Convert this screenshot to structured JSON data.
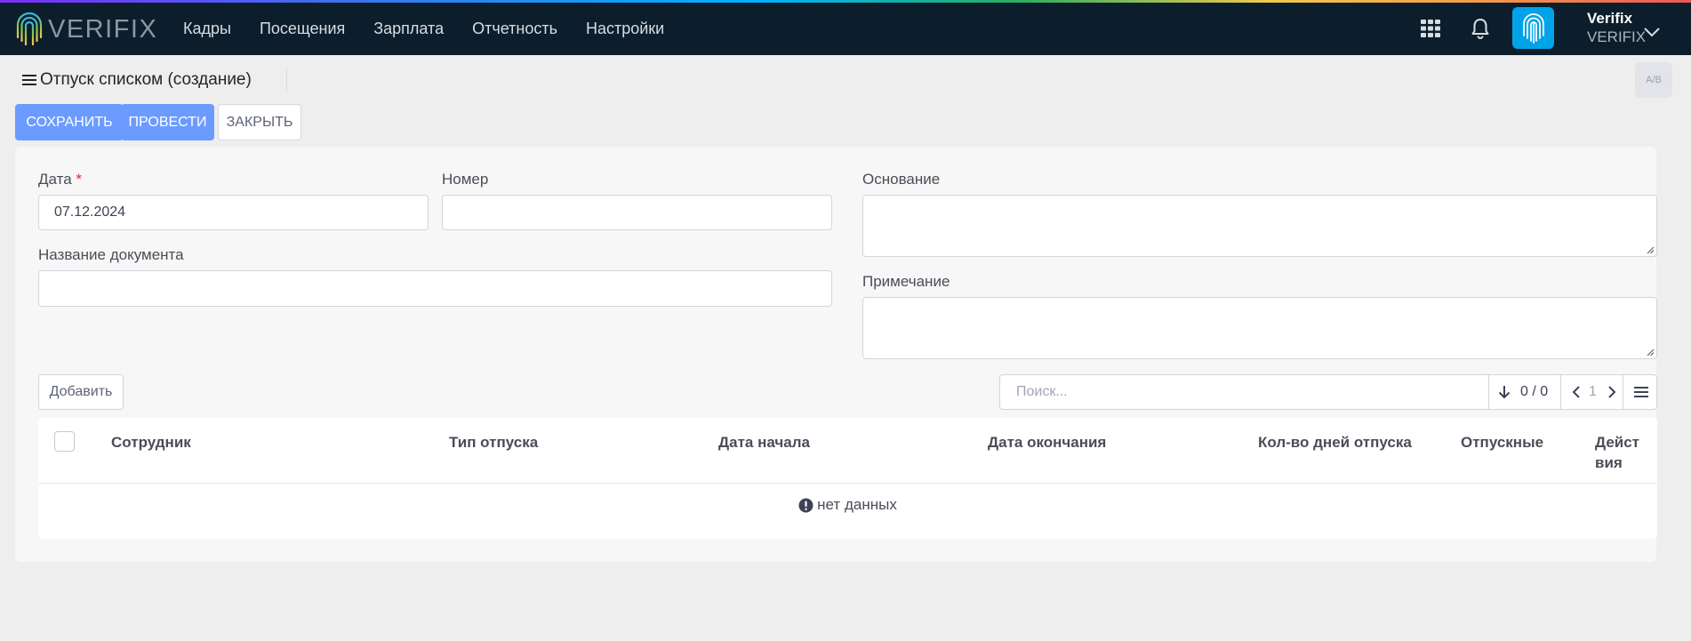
{
  "app": {
    "brand": "VERIFIX",
    "nav": [
      "Кадры",
      "Посещения",
      "Зарплата",
      "Отчетность",
      "Настройки"
    ],
    "user": {
      "name": "Verifix",
      "org": "VERIFIX"
    },
    "icons": {
      "apps": "grid-icon",
      "bell": "bell-icon",
      "avatar": "fingerprint-icon",
      "chevron": "chevron-down-icon"
    }
  },
  "page": {
    "title": "Отпуск списком (создание)",
    "lang_toggle": "A/B"
  },
  "toolbar": {
    "save": "СОХРАНИТЬ",
    "post": "ПРОВЕСТИ",
    "close": "ЗАКРЫТЬ"
  },
  "form": {
    "date_label": "Дата",
    "date_required": "*",
    "date_value": "07.12.2024",
    "number_label": "Номер",
    "number_value": "",
    "doc_name_label": "Название документа",
    "doc_name_value": "",
    "basis_label": "Основание",
    "note_label": "Примечание"
  },
  "grid": {
    "add_button": "Добавить",
    "search_placeholder": "Поиск...",
    "count": "0 / 0",
    "page": "1",
    "columns": [
      "Сотрудник",
      "Тип отпуска",
      "Дата начала",
      "Дата окончания",
      "Кол-во дней отпуска",
      "Отпускные",
      "Действия"
    ],
    "actions_col_line1": "Дейст",
    "actions_col_line2": "вия",
    "empty_text": "нет данных"
  },
  "colors": {
    "navbar": "#0c1e2c",
    "primary": "#6b9bff",
    "avatar": "#00a3e8",
    "required": "#e5254a"
  }
}
